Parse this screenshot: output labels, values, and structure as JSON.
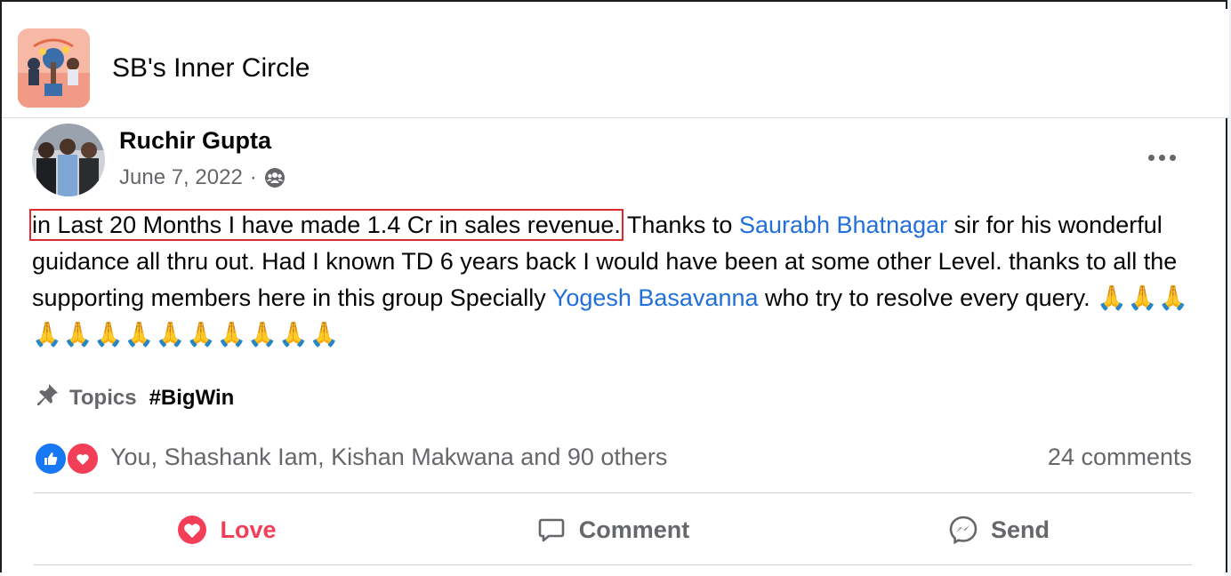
{
  "group": {
    "name": "SB's Inner Circle"
  },
  "post": {
    "author": "Ruchir Gupta",
    "date": "June 7, 2022",
    "date_separator": "·",
    "body": {
      "highlighted": "in Last 20 Months I have made 1.4 Cr in sales revenue.",
      "text1": " Thanks to ",
      "mention1": "Saurabh Bhatnagar",
      "text2": " sir for his wonderful guidance all thru out. Had I known TD 6 years back I would have been at some other Level. thanks to all the supporting members here in this group Specially ",
      "mention2": "Yogesh Basavanna",
      "text3": " who try to resolve every query. ",
      "emojis": "🙏🙏🙏🙏🙏🙏🙏🙏🙏🙏🙏🙏🙏"
    },
    "topics_label": "Topics",
    "topic": "#BigWin",
    "reactions_text": "You, Shashank Iam, Kishan Makwana and 90 others",
    "comments_text": "24 comments"
  },
  "actions": {
    "love": "Love",
    "comment": "Comment",
    "send": "Send"
  },
  "colors": {
    "love": "#f33e58",
    "like": "#1877f2",
    "mention": "#216fdb",
    "highlight_box": "#e0292f"
  }
}
